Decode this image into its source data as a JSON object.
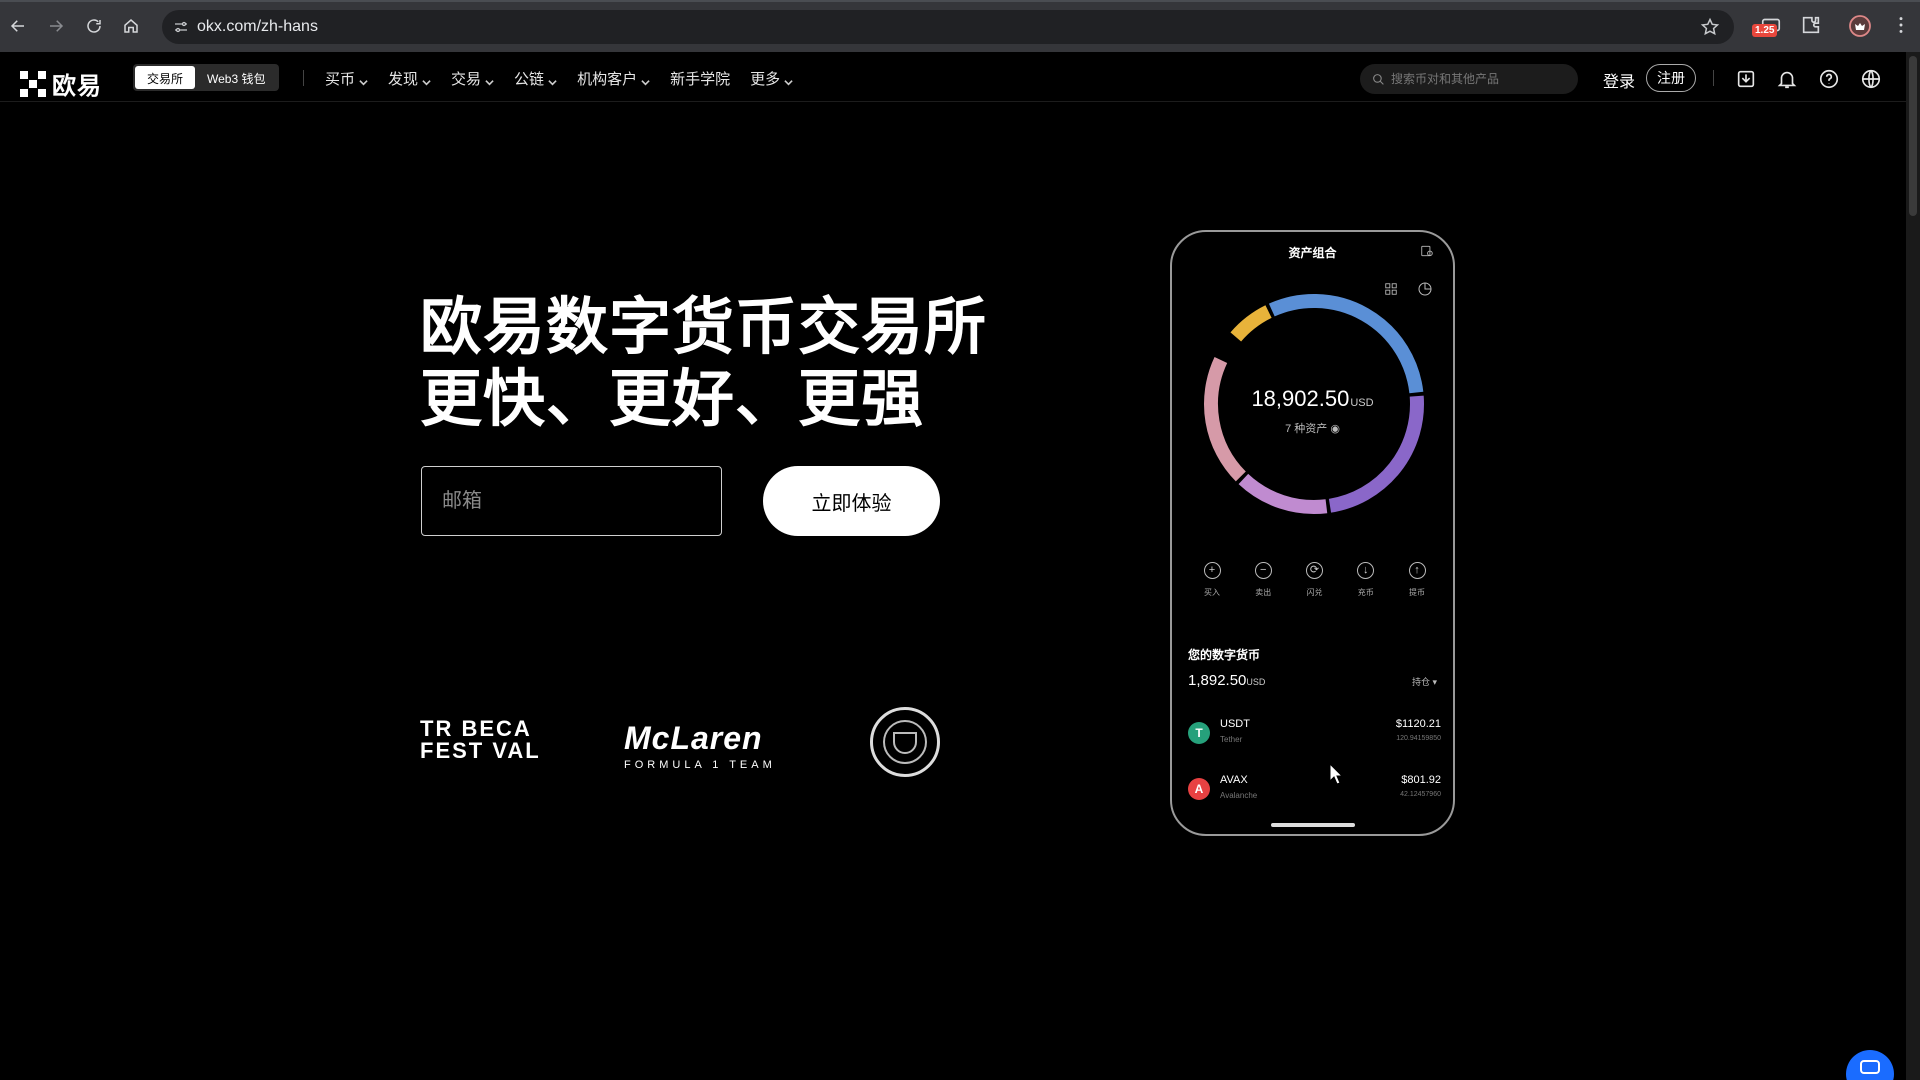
{
  "browser": {
    "url": "okx.com/zh-hans",
    "extension_badge": "1.25"
  },
  "header": {
    "logo_text": "欧易",
    "segments": [
      "交易所",
      "Web3 钱包"
    ],
    "menu": [
      {
        "label": "买币",
        "dropdown": true
      },
      {
        "label": "发现",
        "dropdown": true
      },
      {
        "label": "交易",
        "dropdown": true
      },
      {
        "label": "公链",
        "dropdown": true
      },
      {
        "label": "机构客户",
        "dropdown": true
      },
      {
        "label": "新手学院",
        "dropdown": false
      },
      {
        "label": "更多",
        "dropdown": true
      }
    ],
    "search_placeholder": "搜索币对和其他产品",
    "login_label": "登录",
    "signup_label": "注册",
    "icons": [
      "download-icon",
      "bell-icon",
      "help-icon",
      "globe-icon"
    ]
  },
  "hero": {
    "title_line1": "欧易数字货币交易所",
    "title_line2": "更快、更好、更强",
    "email_placeholder": "邮箱",
    "cta_label": "立即体验"
  },
  "partners": {
    "tribeca_line1": "TR BECA",
    "tribeca_line2": "FEST VAL",
    "mclaren_name": "McLaren",
    "mclaren_sub": "FORMULA 1 TEAM"
  },
  "phone": {
    "title": "资产组合",
    "total_value": "18,902.50",
    "total_unit": "USD",
    "asset_count": "7 种资产",
    "donut_colors": [
      "#e8b33a",
      "#5a8fd6",
      "#8a67c9",
      "#c08bd0",
      "#d69aa8"
    ],
    "donut_fractions": [
      0.07,
      0.305,
      0.243,
      0.145,
      0.2
    ],
    "actions": [
      {
        "label": "买入",
        "icon": "plus-icon",
        "glyph": "+"
      },
      {
        "label": "卖出",
        "icon": "minus-icon",
        "glyph": "−"
      },
      {
        "label": "闪兑",
        "icon": "swap-icon",
        "glyph": "⟳"
      },
      {
        "label": "充币",
        "icon": "deposit-icon",
        "glyph": "↓"
      },
      {
        "label": "提币",
        "icon": "withdraw-icon",
        "glyph": "↑"
      }
    ],
    "section_title": "您的数字货币",
    "section_value": "1,892.50",
    "section_unit": "USD",
    "hold_label": "持仓 ▾",
    "coins": [
      {
        "symbol": "USDT",
        "name": "Tether",
        "amount": "$1120.21",
        "qty": "120.94159850",
        "color": "#26a17b",
        "glyph": "T"
      },
      {
        "symbol": "AVAX",
        "name": "Avalanche",
        "amount": "$801.92",
        "qty": "42.12457960",
        "color": "#e84142",
        "glyph": "A"
      }
    ]
  }
}
